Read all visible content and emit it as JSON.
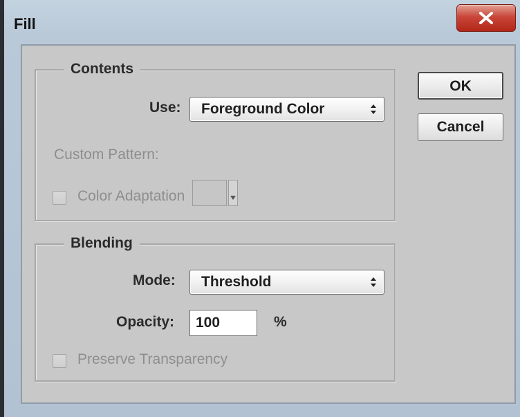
{
  "window": {
    "title": "Fill",
    "close_glyph": "x"
  },
  "contents": {
    "legend": "Contents",
    "use_label": "Use:",
    "use_value": "Foreground Color",
    "custom_pattern_label": "Custom Pattern:",
    "color_adaptation_label": "Color Adaptation",
    "color_adaptation_checked": false
  },
  "blending": {
    "legend": "Blending",
    "mode_label": "Mode:",
    "mode_value": "Threshold",
    "opacity_label": "Opacity:",
    "opacity_value": "100",
    "opacity_unit": "%",
    "preserve_transparency_label": "Preserve Transparency",
    "preserve_transparency_checked": false
  },
  "buttons": {
    "ok_label": "OK",
    "cancel_label": "Cancel"
  },
  "icons": {
    "close": "close-icon",
    "select_arrows": "up-down-arrows-icon",
    "dropdown": "chevron-down-icon"
  },
  "colors": {
    "close_button": "#c9473a",
    "dialog_background": "#c8c8c8",
    "frame": "#b9c9d8"
  }
}
